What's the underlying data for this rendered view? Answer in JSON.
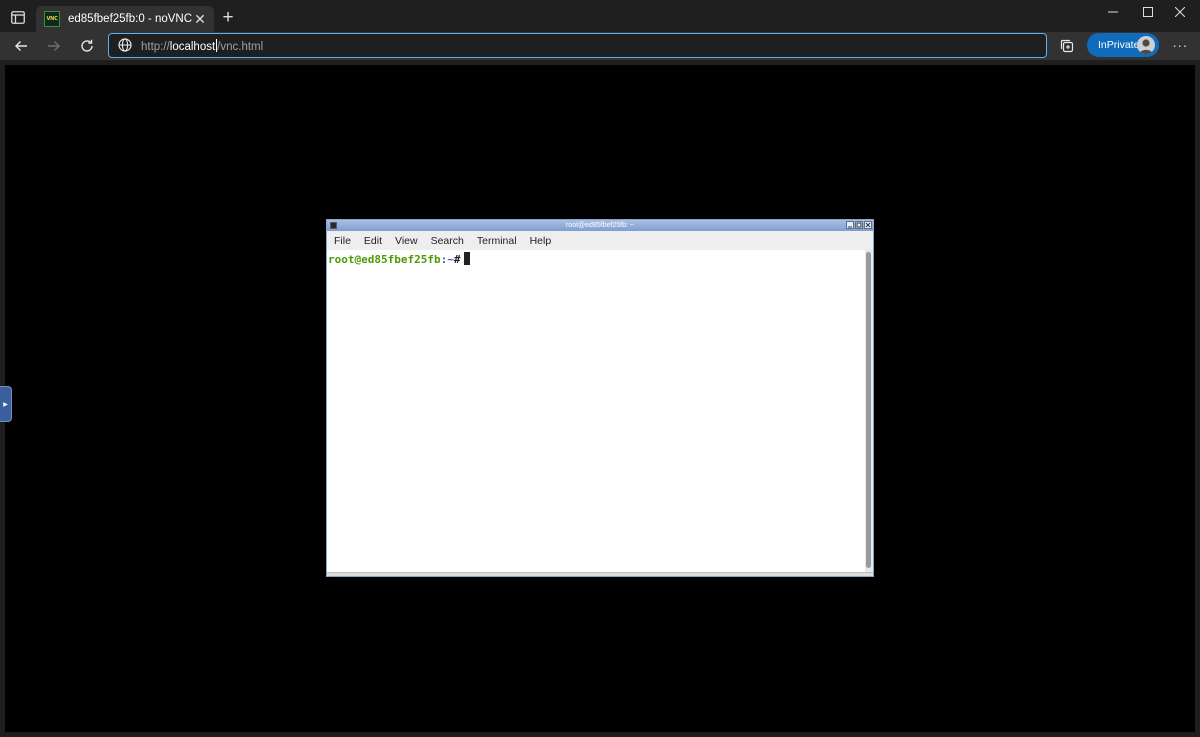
{
  "browser": {
    "tab": {
      "title": "ed85fbef25fb:0 - noVNC",
      "favicon_text": "VNC",
      "close_glyph": "✕"
    },
    "new_tab_glyph": "+",
    "address": {
      "scheme": "http://",
      "host": "localhost",
      "path": "/vnc.html"
    },
    "inprivate_label": "InPrivate",
    "more_glyph": "···",
    "accent_color": "#0f6cbd"
  },
  "terminal": {
    "title": "root@ed85fbef25fb: ~",
    "menu": [
      "File",
      "Edit",
      "View",
      "Search",
      "Terminal",
      "Help"
    ],
    "prompt_user": "root@ed85fbef25fb",
    "prompt_path": ":~",
    "prompt_hash": "#",
    "prompt_color": "#4e9a06"
  }
}
